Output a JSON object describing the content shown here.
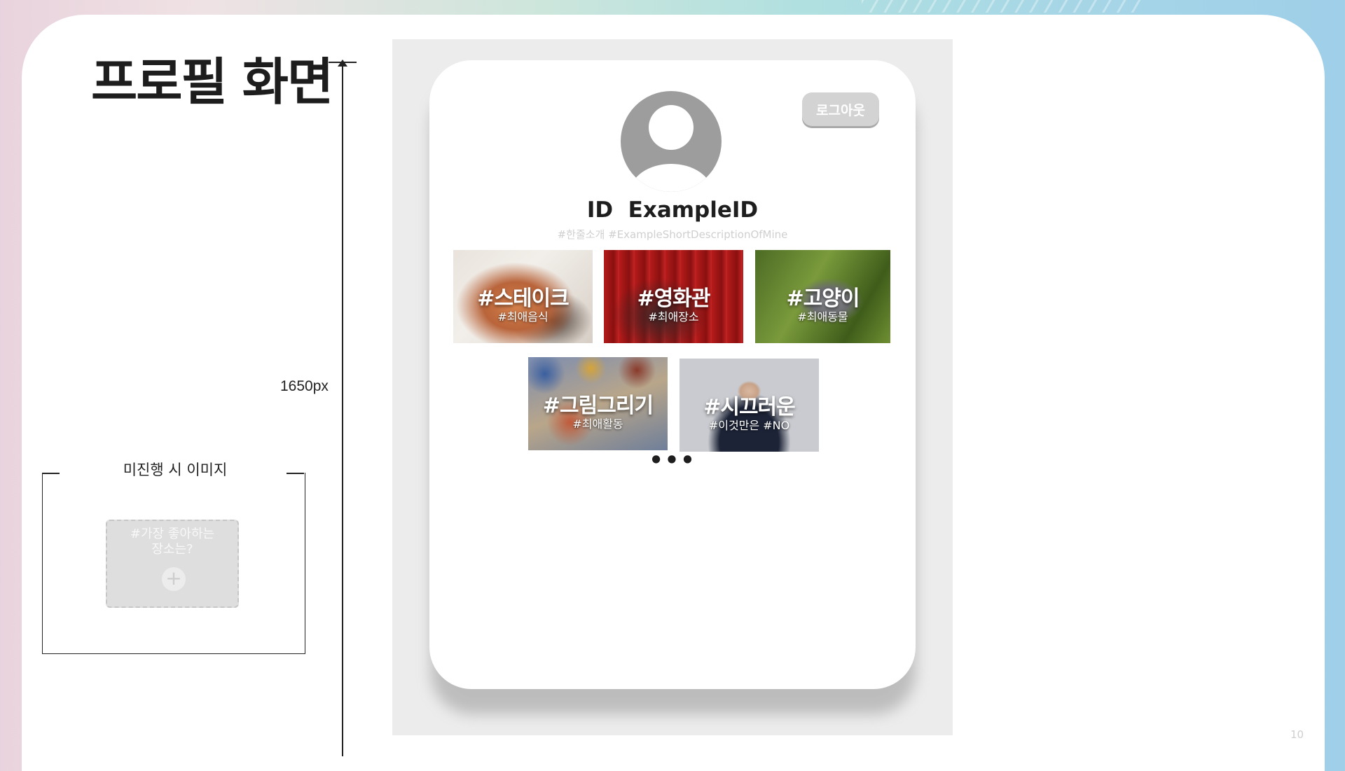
{
  "slide": {
    "title": "프로필 화면",
    "dimension_label": "1650px",
    "page_number": "10"
  },
  "unfinished_state": {
    "title": "미진행 시 이미지",
    "card_text_line1": "#가장 좋아하는",
    "card_text_line2": "장소는?",
    "add_icon": "plus-icon"
  },
  "profile": {
    "logout_label": "로그아웃",
    "user_id": "ID  ExampleID",
    "description": "#한줄소개 #ExampleShortDescriptionOfMine",
    "more_indicator": "•••",
    "avatar_icon": "user-avatar-icon"
  },
  "tiles": [
    {
      "tag": "#스테이크",
      "sub": "#최애음식"
    },
    {
      "tag": "#영화관",
      "sub": "#최애장소"
    },
    {
      "tag": "#고양이",
      "sub": "#최애동물"
    },
    {
      "tag": "#그림그리기",
      "sub": "#최애활동"
    },
    {
      "tag": "#시끄러운",
      "sub": "#이것만은 #NO"
    }
  ]
}
